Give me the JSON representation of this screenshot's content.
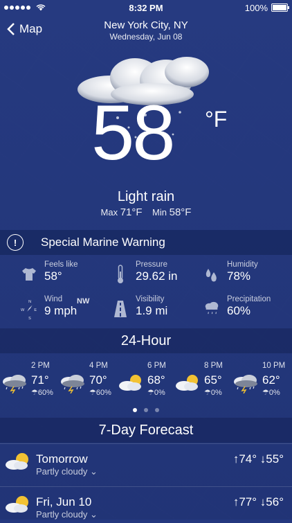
{
  "status": {
    "time": "8:32 PM",
    "battery": "100%",
    "battery_level": 1.0
  },
  "nav": {
    "back_label": "Map",
    "city": "New York City, NY",
    "date": "Wednesday, Jun 08"
  },
  "current": {
    "temp": "58",
    "unit": "°F",
    "condition": "Light rain",
    "max_label": "Max",
    "max": "71°F",
    "min_label": "Min",
    "min": "58°F",
    "icon": "cloud-rain-icon"
  },
  "warning": {
    "text": "Special Marine Warning",
    "icon": "exclamation-circle-icon"
  },
  "details": [
    {
      "label": "Feels like",
      "value": "58°",
      "icon": "tshirt-icon"
    },
    {
      "label": "Pressure",
      "value": "29.62 in",
      "icon": "thermometer-icon"
    },
    {
      "label": "Humidity",
      "value": "78%",
      "icon": "droplets-icon"
    },
    {
      "label": "Wind",
      "value": "9 mph",
      "direction": "NW",
      "icon": "compass-icon"
    },
    {
      "label": "Visibility",
      "value": "1.9 mi",
      "icon": "road-icon"
    },
    {
      "label": "Precipitation",
      "value": "60%",
      "icon": "cloud-rain-icon"
    }
  ],
  "hourly": {
    "title": "24-Hour",
    "items": [
      {
        "time": "2 PM",
        "temp": "71°",
        "rain": "60%",
        "icon": "storm-icon"
      },
      {
        "time": "4 PM",
        "temp": "70°",
        "rain": "60%",
        "icon": "storm-icon"
      },
      {
        "time": "6 PM",
        "temp": "68°",
        "rain": "0%",
        "icon": "partly-cloudy-icon"
      },
      {
        "time": "8 PM",
        "temp": "65°",
        "rain": "0%",
        "icon": "partly-cloudy-icon"
      },
      {
        "time": "10 PM",
        "temp": "62°",
        "rain": "0%",
        "icon": "storm-icon"
      }
    ],
    "pages": 3,
    "active_page": 0
  },
  "weekly": {
    "title": "7-Day Forecast",
    "days": [
      {
        "name": "Tomorrow",
        "desc": "Partly cloudy",
        "high": "↑74°",
        "low": "↓55°",
        "icon": "partly-cloudy-icon"
      },
      {
        "name": "Fri, Jun 10",
        "desc": "Partly cloudy",
        "high": "↑77°",
        "low": "↓56°",
        "icon": "partly-cloudy-icon"
      }
    ]
  },
  "colors": {
    "background": "#24387f",
    "band": "#1a2b66",
    "text": "#ffffff"
  }
}
